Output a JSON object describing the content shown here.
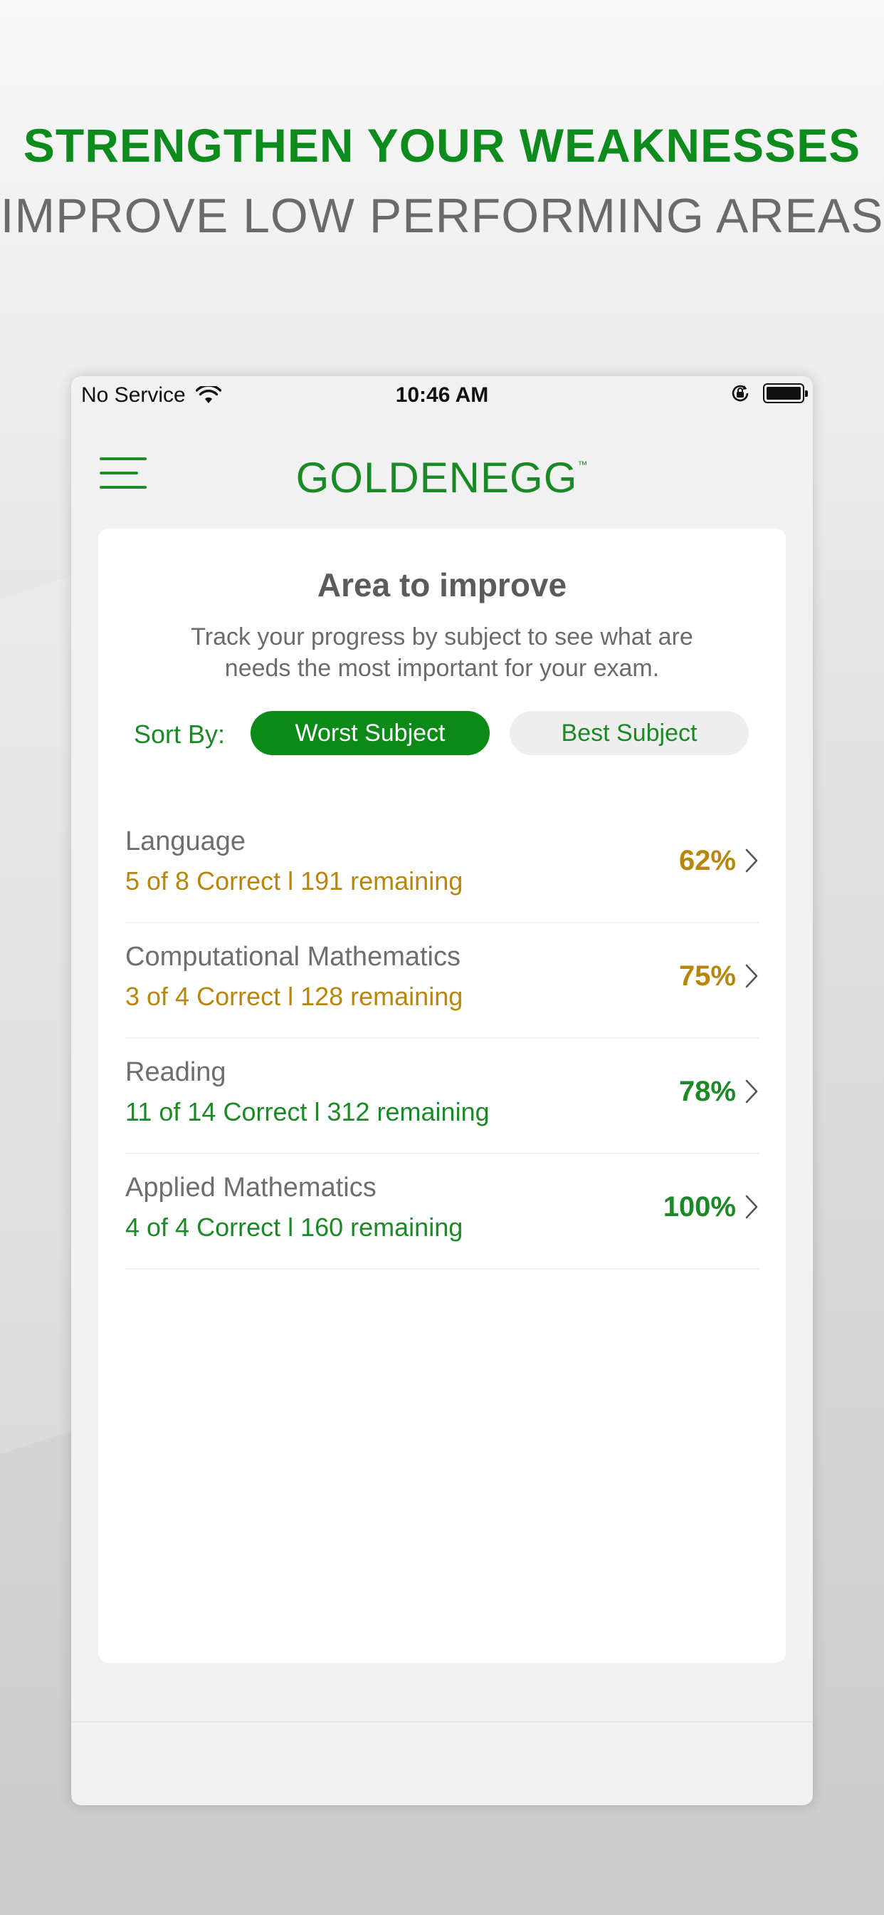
{
  "promo": {
    "headline": "STRENGTHEN YOUR WEAKNESSES",
    "subheadline": "IMPROVE LOW PERFORMING AREAS"
  },
  "status_bar": {
    "carrier": "No Service",
    "time": "10:46 AM"
  },
  "header": {
    "logo_text": "GOLDENEGG",
    "logo_tm": "™"
  },
  "card": {
    "title": "Area to improve",
    "subtitle": "Track your progress by subject to see what are needs the most important for your exam.",
    "sort_label": "Sort By:",
    "sort_options": [
      "Worst Subject",
      "Best Subject"
    ],
    "selected_sort": "Worst Subject"
  },
  "subjects": [
    {
      "name": "Language",
      "detail": "5 of 8  Correct l 191 remaining",
      "percent": "62%",
      "color": "#b8860b"
    },
    {
      "name": "Computational Mathematics",
      "detail": "3 of 4  Correct l 128 remaining",
      "percent": "75%",
      "color": "#b8860b"
    },
    {
      "name": "Reading",
      "detail": "11 of 14  Correct l 312 remaining",
      "percent": "78%",
      "color": "#1b8a26"
    },
    {
      "name": "Applied Mathematics",
      "detail": "4 of 4  Correct l 160 remaining",
      "percent": "100%",
      "color": "#1b8a26"
    }
  ],
  "colors": {
    "brand_green": "#0b8a18",
    "warning_gold": "#b8860b"
  },
  "icons": {
    "menu": "hamburger-icon",
    "wifi": "wifi-icon",
    "orientation_lock": "orientation-lock-icon",
    "battery": "battery-icon",
    "chevron": "chevron-right-icon"
  }
}
